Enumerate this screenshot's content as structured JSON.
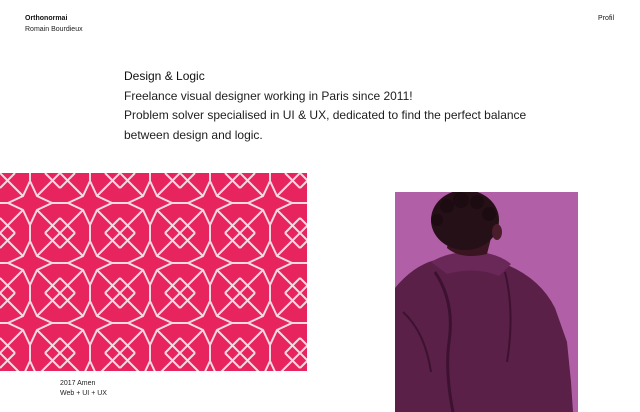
{
  "header": {
    "brand_name": "Orthonormai",
    "author": "Romain Bourdieux",
    "nav_profile": "Profil"
  },
  "intro": {
    "headline": "Design & Logic",
    "line1": "Freelance visual designer working in Paris since 2011!",
    "line2": "Problem solver specialised in UI & UX, dedicated to find the perfect balance",
    "line3": "between design and logic."
  },
  "projects": [
    {
      "year_title": "2017 Amen",
      "tags": "Web + UI + UX",
      "image": "geometric-pattern",
      "color": "#e8245f"
    },
    {
      "image": "portrait-photo",
      "color": "#b15fa6"
    }
  ],
  "colors": {
    "accent_pink": "#e8245f",
    "pattern_line": "#f4dbe2",
    "photo_bg": "#b15fa6",
    "jacket": "#5a2048"
  }
}
